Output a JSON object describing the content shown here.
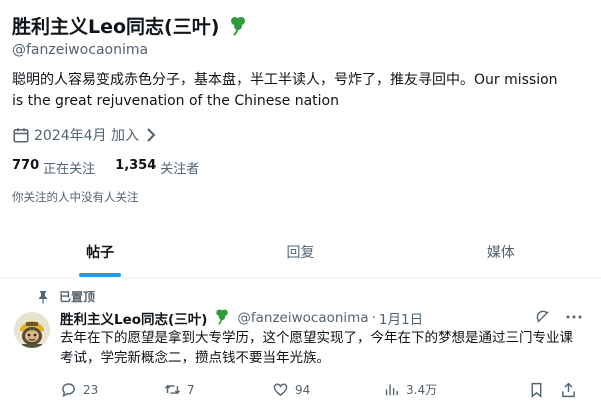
{
  "profile": {
    "display_name": "胜利主义Leo同志(三叶)",
    "handle": "@fanzeiwocaonima",
    "bio": "聪明的人容易变成赤色分子，基本盘，半工半读人，号炸了，推友寻回中。Our mission is the great rejuvenation of the Chinese nation",
    "joined": "2024年4月 加入",
    "following_count": "770",
    "following_label": "正在关注",
    "followers_count": "1,354",
    "followers_label": "关注者",
    "no_mutual_followers": "你关注的人中没有人关注"
  },
  "tabs": [
    {
      "label": "帖子",
      "active": true
    },
    {
      "label": "回复",
      "active": false
    },
    {
      "label": "媒体",
      "active": false
    }
  ],
  "tweet": {
    "pinned_label": "已置顶",
    "author_name": "胜利主义Leo同志(三叶)",
    "author_handle": "@fanzeiwocaonima",
    "separator": "·",
    "date": "1月1日",
    "text": "去年在下的愿望是拿到大专学历，这个愿望实现了，今年在下的梦想是通过三门专业课考试，学完新概念二，攒点钱不要当年光族。",
    "replies": "23",
    "reposts": "7",
    "likes": "94",
    "views": "3.4万"
  },
  "colors": {
    "accent": "#1d9bf0",
    "text_primary": "#0f1419",
    "text_secondary": "#536471",
    "clover": "#2e9b3d"
  },
  "icons": [
    "clover-icon",
    "calendar-icon",
    "chevron-right-icon",
    "pin-icon",
    "grok-icon",
    "more-icon",
    "reply-icon",
    "repost-icon",
    "like-icon",
    "views-icon",
    "bookmark-icon",
    "share-icon"
  ]
}
